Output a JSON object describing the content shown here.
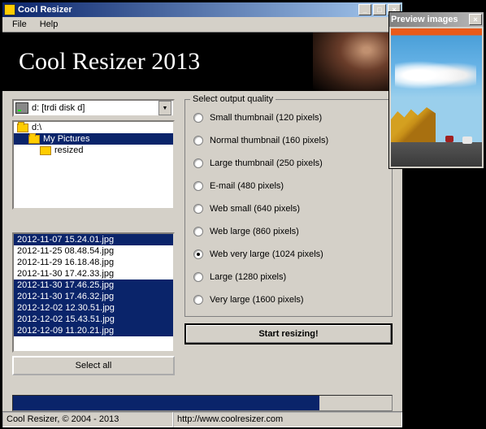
{
  "window": {
    "title": "Cool Resizer",
    "banner_title": "Cool Resizer 2013"
  },
  "menu": {
    "file": "File",
    "help": "Help"
  },
  "drive": {
    "label": "d: [trdi disk d]"
  },
  "folders": {
    "root": "d:\\",
    "pictures": "My Pictures",
    "resized": "resized"
  },
  "files": [
    {
      "name": "2012-11-07 15.24.01.jpg",
      "selected": true
    },
    {
      "name": "2012-11-25 08.48.54.jpg",
      "selected": false
    },
    {
      "name": "2012-11-29 16.18.48.jpg",
      "selected": false
    },
    {
      "name": "2012-11-30 17.42.33.jpg",
      "selected": false
    },
    {
      "name": "2012-11-30 17.46.25.jpg",
      "selected": true
    },
    {
      "name": "2012-11-30 17.46.32.jpg",
      "selected": true
    },
    {
      "name": "2012-12-02 12.30.51.jpg",
      "selected": true
    },
    {
      "name": "2012-12-02 15.43.51.jpg",
      "selected": true
    },
    {
      "name": "2012-12-09 11.20.21.jpg",
      "selected": true
    }
  ],
  "buttons": {
    "select_all": "Select all",
    "start": "Start resizing!"
  },
  "quality": {
    "legend": "Select output quality",
    "options": [
      {
        "label": "Small thumbnail (120 pixels)",
        "checked": false
      },
      {
        "label": "Normal thumbnail (160 pixels)",
        "checked": false
      },
      {
        "label": "Large thumbnail (250 pixels)",
        "checked": false
      },
      {
        "label": "E-mail (480 pixels)",
        "checked": false
      },
      {
        "label": "Web small (640 pixels)",
        "checked": false
      },
      {
        "label": "Web large (860 pixels)",
        "checked": false
      },
      {
        "label": "Web very large (1024 pixels)",
        "checked": true
      },
      {
        "label": "Large (1280 pixels)",
        "checked": false
      },
      {
        "label": "Very large (1600 pixels)",
        "checked": false
      }
    ]
  },
  "progress": {
    "percent": 81
  },
  "status": {
    "copyright": "Cool Resizer, © 2004 - 2013",
    "url": "http://www.coolresizer.com"
  },
  "preview": {
    "title": "Preview images"
  }
}
